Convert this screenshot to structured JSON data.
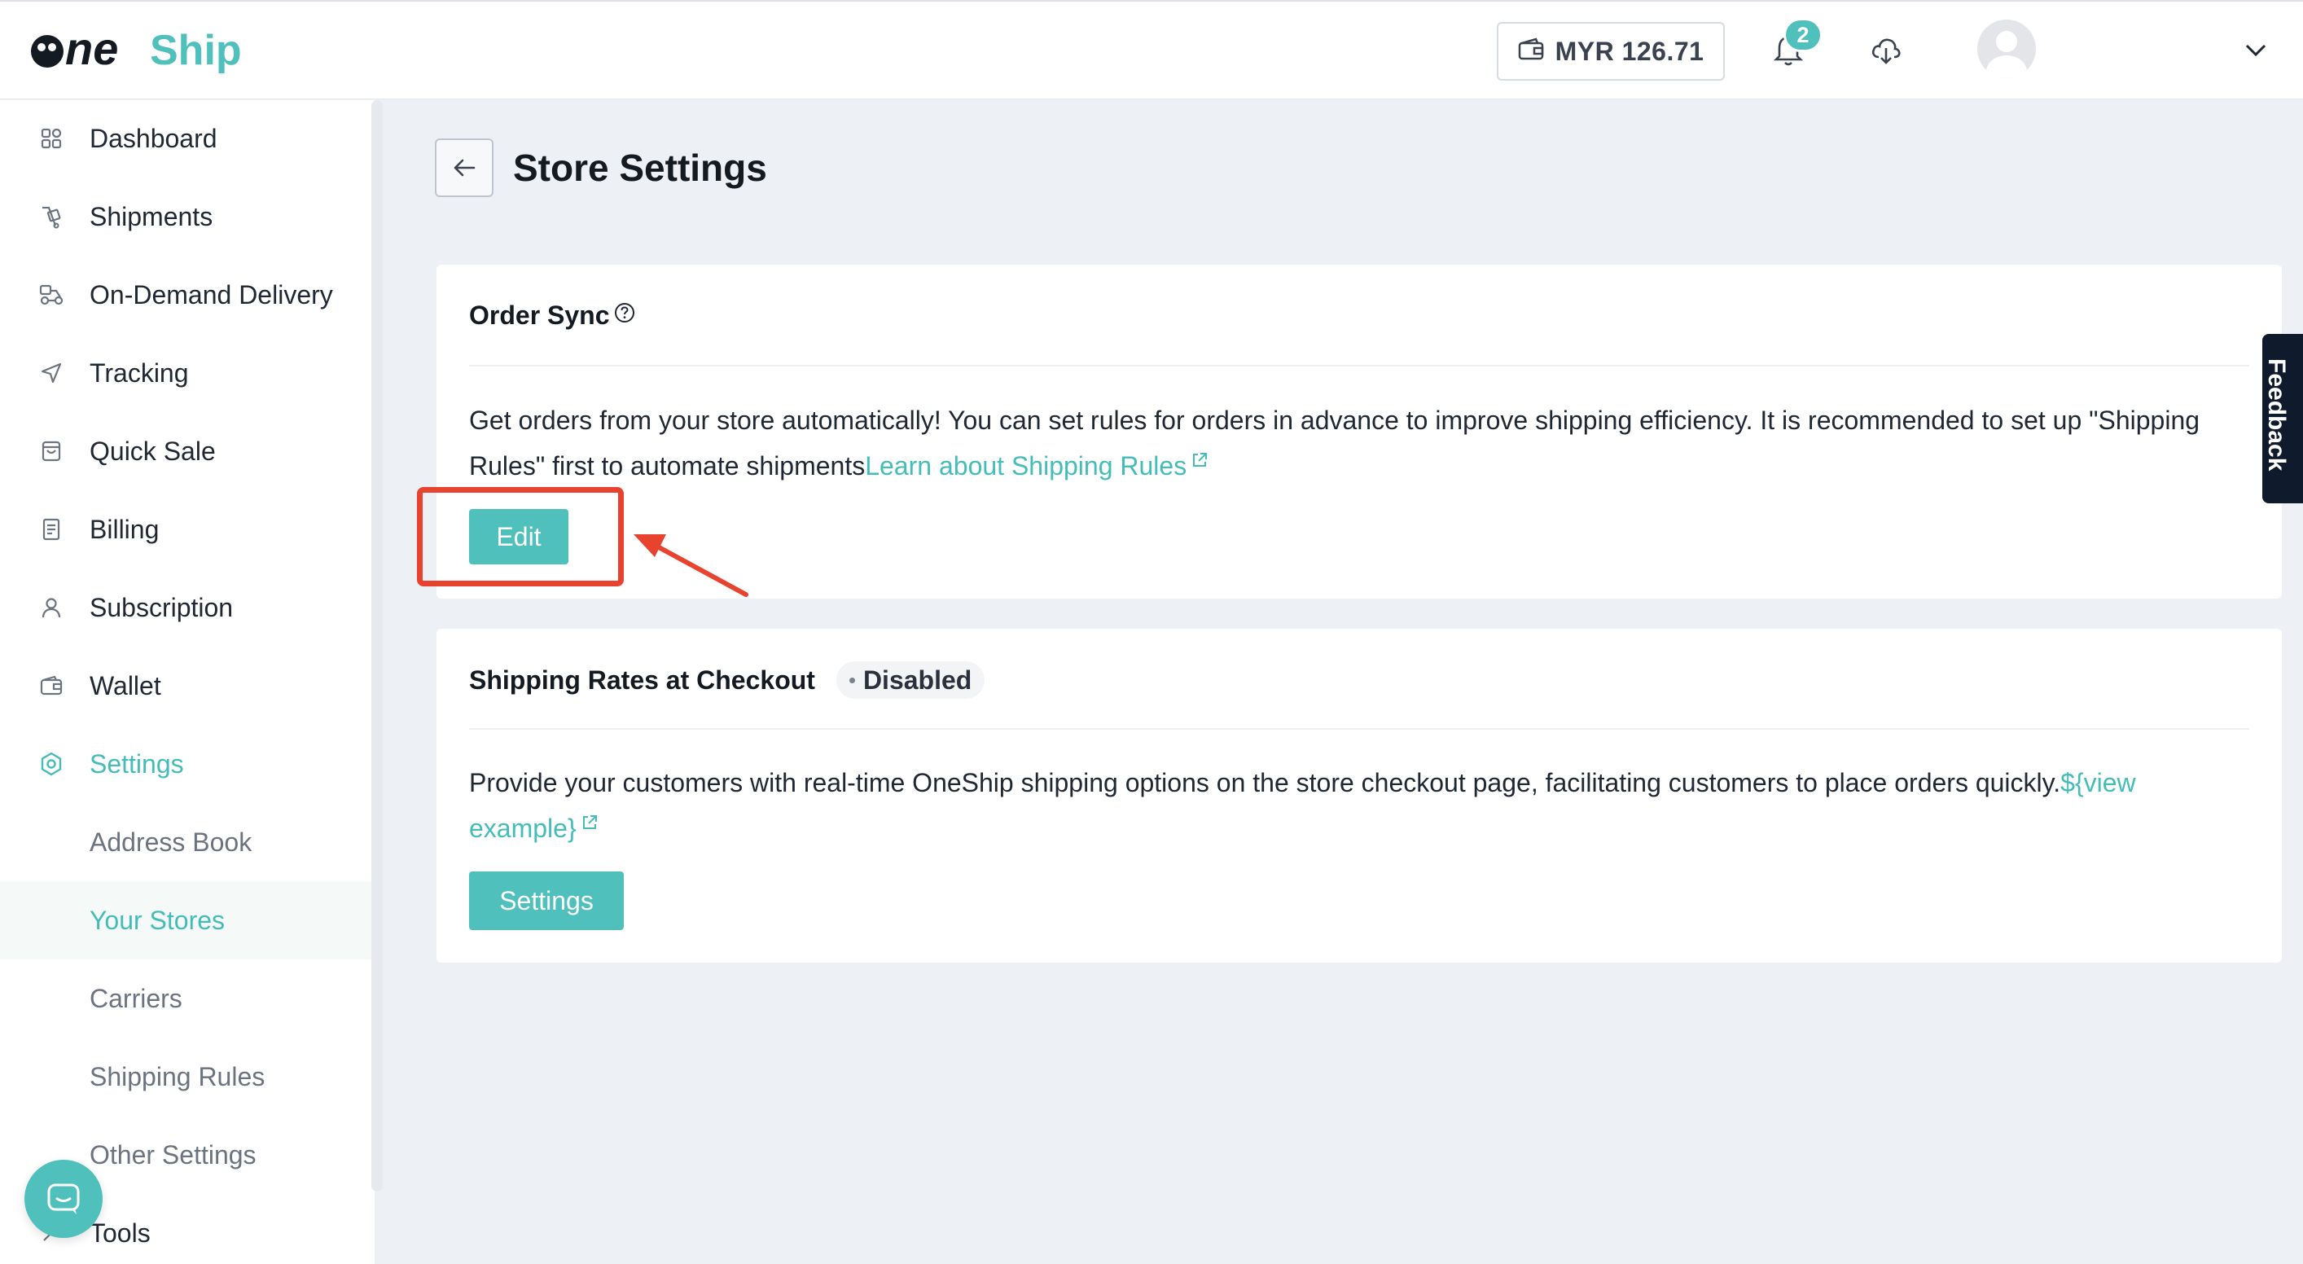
{
  "header": {
    "logo_text": "OneShip",
    "wallet_balance": "MYR 126.71",
    "notification_count": "2",
    "icons": [
      "wallet-icon",
      "bell-icon",
      "cloud-download-icon",
      "avatar",
      "chevron-down-icon"
    ]
  },
  "sidebar": {
    "items": [
      {
        "label": "Dashboard",
        "icon": "grid-icon"
      },
      {
        "label": "Shipments",
        "icon": "parcel-icon"
      },
      {
        "label": "On-Demand Delivery",
        "icon": "scooter-icon"
      },
      {
        "label": "Tracking",
        "icon": "navigation-icon"
      },
      {
        "label": "Quick Sale",
        "icon": "bag-icon"
      },
      {
        "label": "Billing",
        "icon": "receipt-icon"
      },
      {
        "label": "Subscription",
        "icon": "user-icon"
      },
      {
        "label": "Wallet",
        "icon": "wallet-icon"
      },
      {
        "label": "Settings",
        "icon": "gear-icon",
        "active": true
      }
    ],
    "sub_items": [
      {
        "label": "Address Book"
      },
      {
        "label": "Your Stores",
        "selected": true
      },
      {
        "label": "Carriers"
      },
      {
        "label": "Shipping Rules"
      },
      {
        "label": "Other Settings"
      }
    ],
    "tools_label": "Tools"
  },
  "page": {
    "title": "Store Settings"
  },
  "order_sync": {
    "title": "Order Sync",
    "description": "Get orders from your store automatically! You can set rules for orders in advance to improve shipping efficiency. It is recommended to set up \"Shipping Rules\" first to automate shipments",
    "link_text": "Learn about Shipping Rules",
    "button_label": "Edit"
  },
  "shipping_rates": {
    "title": "Shipping Rates at Checkout",
    "status": "Disabled",
    "description": "Provide your customers with real-time OneShip shipping options on the store checkout page, facilitating customers to place orders quickly.",
    "link_text": "${view example}",
    "button_label": "Settings"
  },
  "feedback_label": "Feedback",
  "colors": {
    "accent": "#4fc0bc",
    "annotation": "#e8432f",
    "background": "#edf0f4"
  }
}
